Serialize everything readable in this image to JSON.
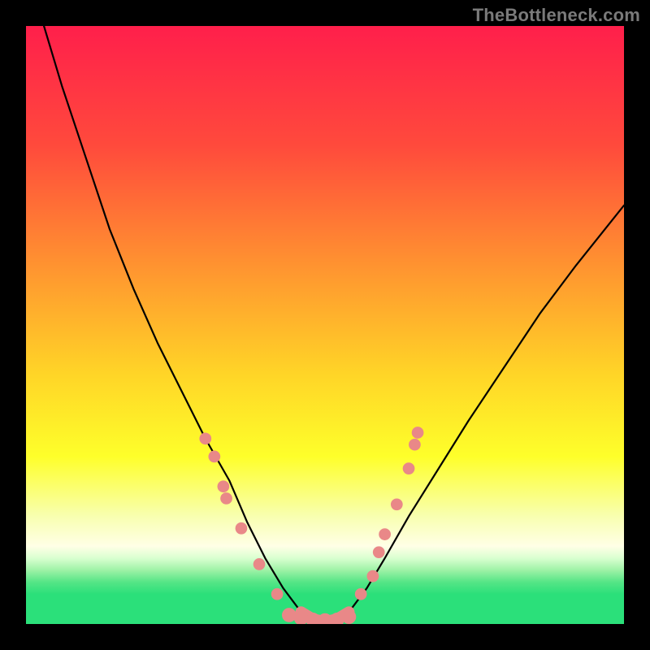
{
  "watermark": "TheBottleneck.com",
  "colors": {
    "border": "#000000",
    "curve": "#000000",
    "dots": "#e98888",
    "green_band": "#2be07a",
    "gradient_stops": [
      {
        "pct": 0,
        "color": "#ff1f4b"
      },
      {
        "pct": 20,
        "color": "#ff4a3c"
      },
      {
        "pct": 42,
        "color": "#ff9a2f"
      },
      {
        "pct": 58,
        "color": "#ffd427"
      },
      {
        "pct": 72,
        "color": "#feff2a"
      },
      {
        "pct": 82,
        "color": "#f8ffb0"
      },
      {
        "pct": 87,
        "color": "#ffffe6"
      },
      {
        "pct": 89,
        "color": "#d9ffd0"
      },
      {
        "pct": 91,
        "color": "#9ef2a6"
      },
      {
        "pct": 93,
        "color": "#55e586"
      },
      {
        "pct": 95,
        "color": "#2be07a"
      },
      {
        "pct": 100,
        "color": "#2be07a"
      }
    ]
  },
  "chart_data": {
    "type": "line",
    "title": "",
    "xlabel": "",
    "ylabel": "",
    "xlim": [
      0,
      100
    ],
    "ylim": [
      0,
      100
    ],
    "series": [
      {
        "name": "left-curve",
        "x": [
          3,
          6,
          10,
          14,
          18,
          22,
          26,
          30,
          34,
          37,
          40,
          43,
          46
        ],
        "y": [
          100,
          90,
          78,
          66,
          56,
          47,
          39,
          31,
          24,
          17,
          11,
          6,
          2
        ]
      },
      {
        "name": "right-curve",
        "x": [
          54,
          57,
          60,
          64,
          69,
          74,
          80,
          86,
          92,
          100
        ],
        "y": [
          2,
          6,
          11,
          18,
          26,
          34,
          43,
          52,
          60,
          70
        ]
      },
      {
        "name": "valley-floor",
        "x": [
          46,
          48,
          50,
          52,
          54
        ],
        "y": [
          2,
          0.8,
          0.4,
          0.8,
          2
        ]
      }
    ],
    "dots_left": [
      {
        "x": 30,
        "y": 31
      },
      {
        "x": 31.5,
        "y": 28
      },
      {
        "x": 33,
        "y": 23
      },
      {
        "x": 33.5,
        "y": 21
      },
      {
        "x": 36,
        "y": 16
      },
      {
        "x": 39,
        "y": 10
      },
      {
        "x": 42,
        "y": 5
      }
    ],
    "dots_right": [
      {
        "x": 56,
        "y": 5
      },
      {
        "x": 58,
        "y": 8
      },
      {
        "x": 59,
        "y": 12
      },
      {
        "x": 60,
        "y": 15
      },
      {
        "x": 62,
        "y": 20
      },
      {
        "x": 64,
        "y": 26
      },
      {
        "x": 65,
        "y": 30
      },
      {
        "x": 65.5,
        "y": 32
      }
    ],
    "dots_bottom": [
      {
        "x": 44,
        "y": 1.5
      },
      {
        "x": 46,
        "y": 1.0
      },
      {
        "x": 48,
        "y": 0.7
      },
      {
        "x": 50,
        "y": 0.6
      },
      {
        "x": 52,
        "y": 0.7
      },
      {
        "x": 54,
        "y": 1.2
      }
    ]
  }
}
